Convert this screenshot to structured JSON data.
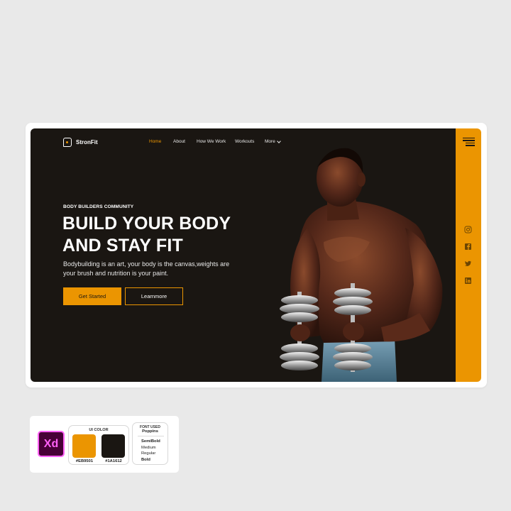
{
  "brand": {
    "name": "StronFit"
  },
  "nav": {
    "items": [
      "Home",
      "About",
      "How We Work",
      "Workouts",
      "More"
    ]
  },
  "hero": {
    "eyebrow": "BODY BUILDERS COMMUNITY",
    "headline_line1": "BUILD YOUR BODY",
    "headline_line2": "AND STAY FIT",
    "subtext": "Bodybuilding is an art, your body is the canvas,weights are your brush and nutrition is your paint.",
    "primary_button": "Get Started",
    "secondary_button": "Learnmore"
  },
  "rail": {
    "icons": [
      "instagram-icon",
      "facebook-icon",
      "twitter-icon",
      "linkedin-icon"
    ]
  },
  "info": {
    "tool_label": "Xd",
    "color_title": "UI COLOR",
    "colors": [
      {
        "hex": "#EB9501",
        "label": "#EB9501"
      },
      {
        "hex": "#1A1612",
        "label": "#1A1612"
      }
    ],
    "font_title": "FONT USED",
    "font_name": "Poppins",
    "weights": [
      "SemiBold",
      "Medium",
      "Regular",
      "Bold"
    ]
  },
  "theme": {
    "accent": "#eb9501",
    "dark": "#1a1612"
  }
}
